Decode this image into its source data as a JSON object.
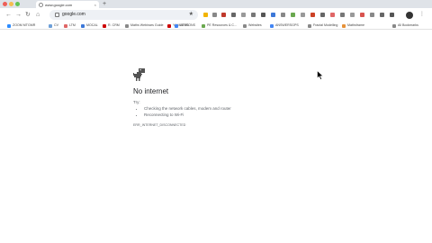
{
  "tab": {
    "title": "www.google.com",
    "close": "×"
  },
  "new_tab": "+",
  "nav": {
    "back": "←",
    "forward": "→",
    "reload": "↻",
    "home": "⌂"
  },
  "omnibox": {
    "url": "google.com",
    "star": "★"
  },
  "bookmarks": [
    {
      "label": "ZOOM MTGMR",
      "color": "#2d8cff"
    },
    {
      "label": "CV",
      "color": "#6ea0d8"
    },
    {
      "label": "LTM",
      "color": "#e06666"
    },
    {
      "label": "MOCAL",
      "color": "#3c78d8"
    },
    {
      "label": "R. CRM",
      "color": "#cc0000"
    },
    {
      "label": "Maths Webinars Guide",
      "color": "#888888"
    },
    {
      "label": "Y4 MATHS",
      "color": "#cc0000"
    },
    {
      "label": "LESSONS",
      "color": "#4285f4"
    },
    {
      "label": "PE Resources & C...",
      "color": "#6aa84f"
    },
    {
      "label": "Websites",
      "color": "#888888"
    },
    {
      "label": "ANSWERSGPS",
      "color": "#4285f4"
    },
    {
      "label": "Fractal Modelling",
      "color": "#888888"
    },
    {
      "label": "Mathsframe",
      "color": "#e69138"
    },
    {
      "label": "All Bookmarks",
      "color": "#888888"
    }
  ],
  "error": {
    "title": "No internet",
    "try": "Try:",
    "items": [
      "Checking the network cables, modem and router",
      "Reconnecting to Wi-Fi"
    ],
    "code": "ERR_INTERNET_DISCONNECTED"
  },
  "colors": {
    "tabstrip": "#dfe3e8",
    "omnibox": "#eef1f5",
    "text": "#202124",
    "muted": "#5f6368"
  },
  "icons": [
    "dino-icon",
    "cursor-icon",
    "profile-avatar-icon",
    "star-icon"
  ]
}
